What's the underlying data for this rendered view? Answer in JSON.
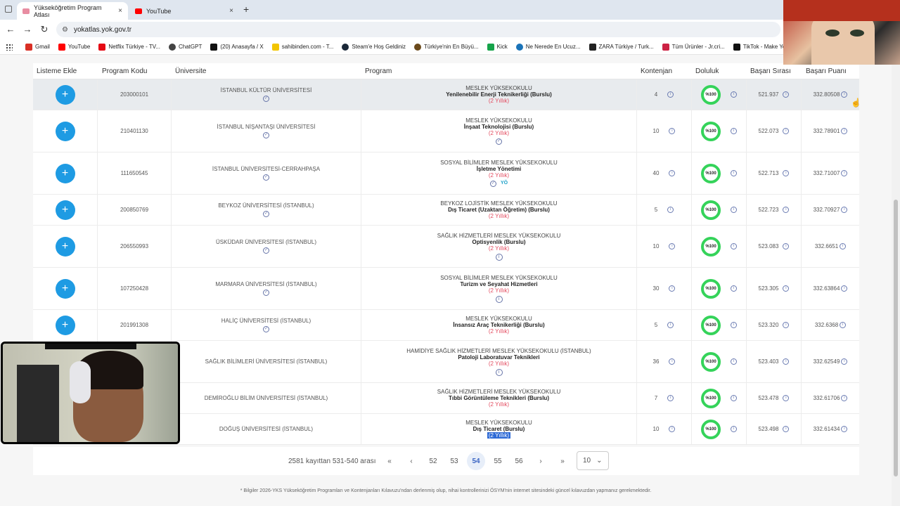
{
  "browser": {
    "tabs": [
      {
        "title": "Yükseköğretim Program Atlası",
        "close": "×",
        "fav_color": "#e88da2"
      },
      {
        "title": "YouTube",
        "close": "×",
        "fav_color": "#ff0000"
      }
    ],
    "new_tab": "+",
    "url": "yokatlas.yok.gov.tr",
    "bookmarks": [
      {
        "label": "Gmail",
        "color": "#d93025"
      },
      {
        "label": "YouTube",
        "color": "#ff0000"
      },
      {
        "label": "Netflix Türkiye - TV...",
        "color": "#e50914"
      },
      {
        "label": "ChatGPT",
        "color": "#444444"
      },
      {
        "label": "(20) Anasayfa / X",
        "color": "#111111"
      },
      {
        "label": "sahibinden.com - T...",
        "color": "#f2c500"
      },
      {
        "label": "Steam'e Hoş Geldiniz",
        "color": "#1b2838"
      },
      {
        "label": "Türkiye'nin En Büyü...",
        "color": "#6b4a1c"
      },
      {
        "label": "Kick",
        "color": "#16a34a"
      },
      {
        "label": "Ne Nerede En Ucuz...",
        "color": "#1a73b8"
      },
      {
        "label": "ZARA Türkiye / Turk...",
        "color": "#222222"
      },
      {
        "label": "Tüm Ürünler - Jr.cri...",
        "color": "#cc2244"
      },
      {
        "label": "TikTok - Make You",
        "color": "#111111"
      }
    ]
  },
  "table": {
    "headers": {
      "add": "Listeme Ekle",
      "code": "Program Kodu",
      "uni": "Üniversite",
      "program": "Program",
      "kontenjan": "Kontenjan",
      "doluluk": "Doluluk",
      "sira": "Başarı Sırası",
      "puan": "Başarı Puanı"
    },
    "rows": [
      {
        "code": "203000101",
        "uni": "İSTANBUL KÜLTÜR ÜNİVERSİTESİ",
        "faculty": "MESLEK YÜKSEKOKULU",
        "program": "Yenilenebilir Enerji Teknikerliği (Burslu)",
        "duration": "(2 Yıllık)",
        "kontenjan": "4",
        "doluluk": "%100",
        "sira": "521.937",
        "puan": "332.80508"
      },
      {
        "code": "210401130",
        "uni": "İSTANBUL NİŞANTAŞI ÜNİVERSİTESİ",
        "faculty": "MESLEK YÜKSEKOKULU",
        "program": "İnşaat Teknolojisi (Burslu)",
        "duration": "(2 Yıllık)",
        "kontenjan": "10",
        "doluluk": "%100",
        "sira": "522.073",
        "puan": "332.78901"
      },
      {
        "code": "111650545",
        "uni": "İSTANBUL ÜNİVERSİTESİ-CERRAHPAŞA",
        "faculty": "SOSYAL BİLİMLER MESLEK YÜKSEKOKULU",
        "program": "İşletme Yönetimi",
        "duration": "(2 Yıllık)",
        "kontenjan": "40",
        "doluluk": "%100",
        "sira": "522.713",
        "puan": "332.71007",
        "badge": "YÖ"
      },
      {
        "code": "200850769",
        "uni": "BEYKOZ ÜNİVERSİTESİ (İSTANBUL)",
        "faculty": "BEYKOZ LOJİSTİK MESLEK YÜKSEKOKULU",
        "program": "Dış Ticaret (Uzaktan Öğretim) (Burslu)",
        "duration": "(2 Yıllık)",
        "kontenjan": "5",
        "doluluk": "%100",
        "sira": "522.723",
        "puan": "332.70927"
      },
      {
        "code": "206550993",
        "uni": "ÜSKÜDAR ÜNİVERSİTESİ (İSTANBUL)",
        "faculty": "SAĞLIK HİZMETLERİ MESLEK YÜKSEKOKULU",
        "program": "Optisyenlik (Burslu)",
        "duration": "(2 Yıllık)",
        "kontenjan": "10",
        "doluluk": "%100",
        "sira": "523.083",
        "puan": "332.6651"
      },
      {
        "code": "107250428",
        "uni": "MARMARA ÜNİVERSİTESİ (İSTANBUL)",
        "faculty": "SOSYAL BİLİMLER MESLEK YÜKSEKOKULU",
        "program": "Turizm ve Seyahat Hizmetleri",
        "duration": "(2 Yıllık)",
        "kontenjan": "30",
        "doluluk": "%100",
        "sira": "523.305",
        "puan": "332.63864"
      },
      {
        "code": "201991308",
        "uni": "HALİÇ ÜNİVERSİTESİ (İSTANBUL)",
        "faculty": "MESLEK YÜKSEKOKULU",
        "program": "İnsansız Araç Teknikerliği (Burslu)",
        "duration": "(2 Yıllık)",
        "kontenjan": "5",
        "doluluk": "%100",
        "sira": "523.320",
        "puan": "332.6368"
      },
      {
        "code": "",
        "uni": "SAĞLIK BİLİMLERİ ÜNİVERSİTESİ (İSTANBUL)",
        "faculty": "HAMİDİYE SAĞLIK HİZMETLERİ MESLEK YÜKSEKOKULU (İSTANBUL)",
        "program": "Patoloji Laboratuvar Teknikleri",
        "duration": "(2 Yıllık)",
        "kontenjan": "36",
        "doluluk": "%100",
        "sira": "523.403",
        "puan": "332.62549"
      },
      {
        "code": "",
        "uni": "DEMİROĞLU BİLİM ÜNİVERSİTESİ (İSTANBUL)",
        "faculty": "SAĞLIK HİZMETLERİ MESLEK YÜKSEKOKULU",
        "program": "Tıbbi Görüntüleme Teknikleri (Burslu)",
        "duration": "(2 Yıllık)",
        "kontenjan": "7",
        "doluluk": "%100",
        "sira": "523.478",
        "puan": "332.61706"
      },
      {
        "code": "",
        "uni": "DOĞUŞ ÜNİVERSİTESİ (İSTANBUL)",
        "faculty": "MESLEK YÜKSEKOKULU",
        "program": "Dış Ticaret (Burslu)",
        "duration": "(2 Yıllık)",
        "kontenjan": "10",
        "doluluk": "%100",
        "sira": "523.498",
        "puan": "332.61434"
      }
    ]
  },
  "pagination": {
    "summary": "2581 kayıttan 531-540 arası",
    "first": "«",
    "prev": "‹",
    "pages": [
      "52",
      "53",
      "54",
      "55",
      "56"
    ],
    "active_page": "54",
    "next": "›",
    "last": "»",
    "page_size": "10",
    "chevron": "⌄"
  },
  "footnote": "* Bilgiler 2026-YKS Yükseköğretim Programları ve Kontenjanları Kılavuzu'ndan derlenmiş olup, nihai kontrollerinizi ÖSYM'nin internet sitesindeki güncel kılavuzdan yapmanız gerekmektedir.",
  "icons": {
    "add": "+",
    "check": "✓",
    "info": "i"
  }
}
